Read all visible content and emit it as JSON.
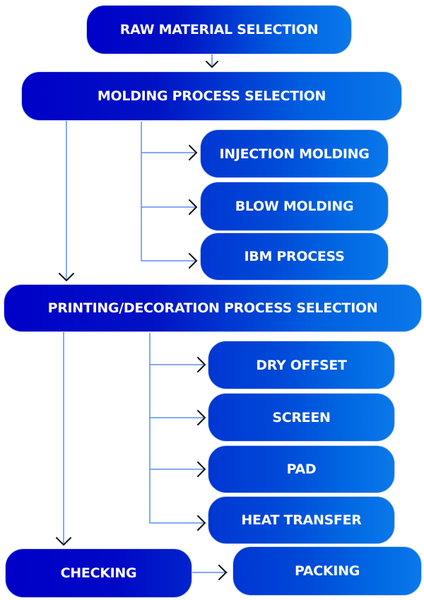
{
  "diagram": {
    "type": "process-flowchart",
    "colors": {
      "box_gradient_start": "#0000c8",
      "box_gradient_end": "#0a78ea",
      "connector_line": "#5b8ef0",
      "arrowhead": "#111111",
      "text": "#ffffff"
    },
    "nodes": {
      "raw_material": "RAW MATERIAL SELECTION",
      "molding": "MOLDING PROCESS SELECTION",
      "molding_options": [
        "INJECTION MOLDING",
        "BLOW MOLDING",
        "IBM PROCESS"
      ],
      "printing": "PRINTING/DECORATION PROCESS SELECTION",
      "printing_options": [
        "DRY OFFSET",
        "SCREEN",
        "PAD",
        "HEAT TRANSFER"
      ],
      "checking": "CHECKING",
      "packing": "PACKING"
    },
    "edges": [
      {
        "from": "RAW MATERIAL SELECTION",
        "to": "MOLDING PROCESS SELECTION"
      },
      {
        "from": "MOLDING PROCESS SELECTION",
        "to": "INJECTION MOLDING"
      },
      {
        "from": "MOLDING PROCESS SELECTION",
        "to": "BLOW MOLDING"
      },
      {
        "from": "MOLDING PROCESS SELECTION",
        "to": "IBM PROCESS"
      },
      {
        "from": "MOLDING PROCESS SELECTION",
        "to": "PRINTING/DECORATION PROCESS SELECTION"
      },
      {
        "from": "PRINTING/DECORATION PROCESS SELECTION",
        "to": "DRY OFFSET"
      },
      {
        "from": "PRINTING/DECORATION PROCESS SELECTION",
        "to": "SCREEN"
      },
      {
        "from": "PRINTING/DECORATION PROCESS SELECTION",
        "to": "PAD"
      },
      {
        "from": "PRINTING/DECORATION PROCESS SELECTION",
        "to": "HEAT TRANSFER"
      },
      {
        "from": "PRINTING/DECORATION PROCESS SELECTION",
        "to": "CHECKING"
      },
      {
        "from": "CHECKING",
        "to": "PACKING"
      }
    ]
  }
}
